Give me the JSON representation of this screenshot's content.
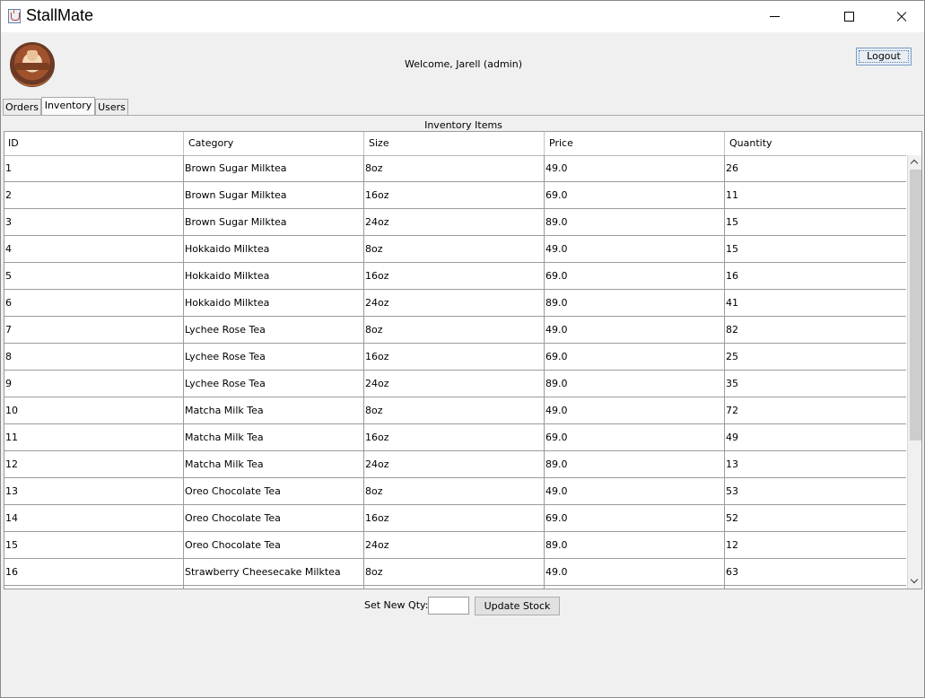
{
  "window": {
    "title": "StallMate"
  },
  "header": {
    "welcome": "Welcome, Jarell (admin)",
    "logout_label": "Logout"
  },
  "tabs": [
    {
      "label": "Orders",
      "selected": false
    },
    {
      "label": "Inventory",
      "selected": true
    },
    {
      "label": "Users",
      "selected": false
    }
  ],
  "inventory": {
    "title": "Inventory Items",
    "columns": [
      "ID",
      "Category",
      "Size",
      "Price",
      "Quantity"
    ],
    "rows": [
      [
        "1",
        "Brown Sugar Milktea",
        "8oz",
        "49.0",
        "26"
      ],
      [
        "2",
        "Brown Sugar Milktea",
        "16oz",
        "69.0",
        "11"
      ],
      [
        "3",
        "Brown Sugar Milktea",
        "24oz",
        "89.0",
        "15"
      ],
      [
        "4",
        "Hokkaido Milktea",
        "8oz",
        "49.0",
        "15"
      ],
      [
        "5",
        "Hokkaido Milktea",
        "16oz",
        "69.0",
        "16"
      ],
      [
        "6",
        "Hokkaido Milktea",
        "24oz",
        "89.0",
        "41"
      ],
      [
        "7",
        "Lychee Rose Tea",
        "8oz",
        "49.0",
        "82"
      ],
      [
        "8",
        "Lychee Rose Tea",
        "16oz",
        "69.0",
        "25"
      ],
      [
        "9",
        "Lychee Rose Tea",
        "24oz",
        "89.0",
        "35"
      ],
      [
        "10",
        "Matcha Milk Tea",
        "8oz",
        "49.0",
        "72"
      ],
      [
        "11",
        "Matcha Milk Tea",
        "16oz",
        "69.0",
        "49"
      ],
      [
        "12",
        "Matcha Milk Tea",
        "24oz",
        "89.0",
        "13"
      ],
      [
        "13",
        "Oreo Chocolate Tea",
        "8oz",
        "49.0",
        "53"
      ],
      [
        "14",
        "Oreo Chocolate Tea",
        "16oz",
        "69.0",
        "52"
      ],
      [
        "15",
        "Oreo Chocolate Tea",
        "24oz",
        "89.0",
        "12"
      ],
      [
        "16",
        "Strawberry Cheesecake Milktea",
        "8oz",
        "49.0",
        "63"
      ],
      [
        "",
        "",
        "",
        "",
        ""
      ]
    ]
  },
  "controls": {
    "qty_label": "Set New Qty:",
    "qty_value": "",
    "update_label": "Update Stock"
  }
}
